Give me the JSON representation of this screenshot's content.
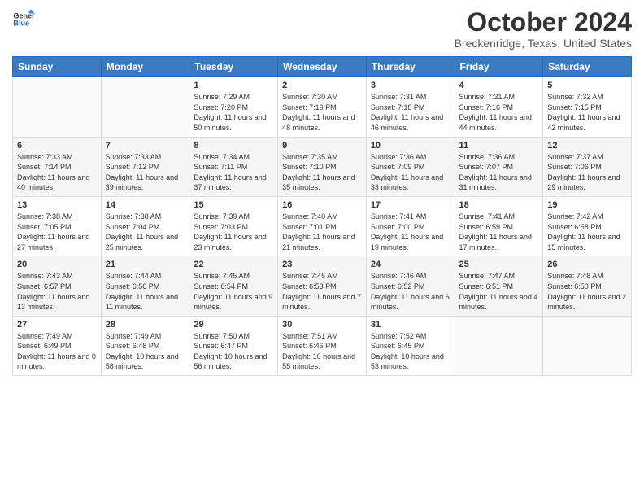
{
  "logo": {
    "line1": "General",
    "line2": "Blue"
  },
  "title": "October 2024",
  "subtitle": "Breckenridge, Texas, United States",
  "weekdays": [
    "Sunday",
    "Monday",
    "Tuesday",
    "Wednesday",
    "Thursday",
    "Friday",
    "Saturday"
  ],
  "weeks": [
    [
      {
        "day": "",
        "info": ""
      },
      {
        "day": "",
        "info": ""
      },
      {
        "day": "1",
        "info": "Sunrise: 7:29 AM\nSunset: 7:20 PM\nDaylight: 11 hours and 50 minutes."
      },
      {
        "day": "2",
        "info": "Sunrise: 7:30 AM\nSunset: 7:19 PM\nDaylight: 11 hours and 48 minutes."
      },
      {
        "day": "3",
        "info": "Sunrise: 7:31 AM\nSunset: 7:18 PM\nDaylight: 11 hours and 46 minutes."
      },
      {
        "day": "4",
        "info": "Sunrise: 7:31 AM\nSunset: 7:16 PM\nDaylight: 11 hours and 44 minutes."
      },
      {
        "day": "5",
        "info": "Sunrise: 7:32 AM\nSunset: 7:15 PM\nDaylight: 11 hours and 42 minutes."
      }
    ],
    [
      {
        "day": "6",
        "info": "Sunrise: 7:33 AM\nSunset: 7:14 PM\nDaylight: 11 hours and 40 minutes."
      },
      {
        "day": "7",
        "info": "Sunrise: 7:33 AM\nSunset: 7:12 PM\nDaylight: 11 hours and 39 minutes."
      },
      {
        "day": "8",
        "info": "Sunrise: 7:34 AM\nSunset: 7:11 PM\nDaylight: 11 hours and 37 minutes."
      },
      {
        "day": "9",
        "info": "Sunrise: 7:35 AM\nSunset: 7:10 PM\nDaylight: 11 hours and 35 minutes."
      },
      {
        "day": "10",
        "info": "Sunrise: 7:36 AM\nSunset: 7:09 PM\nDaylight: 11 hours and 33 minutes."
      },
      {
        "day": "11",
        "info": "Sunrise: 7:36 AM\nSunset: 7:07 PM\nDaylight: 11 hours and 31 minutes."
      },
      {
        "day": "12",
        "info": "Sunrise: 7:37 AM\nSunset: 7:06 PM\nDaylight: 11 hours and 29 minutes."
      }
    ],
    [
      {
        "day": "13",
        "info": "Sunrise: 7:38 AM\nSunset: 7:05 PM\nDaylight: 11 hours and 27 minutes."
      },
      {
        "day": "14",
        "info": "Sunrise: 7:38 AM\nSunset: 7:04 PM\nDaylight: 11 hours and 25 minutes."
      },
      {
        "day": "15",
        "info": "Sunrise: 7:39 AM\nSunset: 7:03 PM\nDaylight: 11 hours and 23 minutes."
      },
      {
        "day": "16",
        "info": "Sunrise: 7:40 AM\nSunset: 7:01 PM\nDaylight: 11 hours and 21 minutes."
      },
      {
        "day": "17",
        "info": "Sunrise: 7:41 AM\nSunset: 7:00 PM\nDaylight: 11 hours and 19 minutes."
      },
      {
        "day": "18",
        "info": "Sunrise: 7:41 AM\nSunset: 6:59 PM\nDaylight: 11 hours and 17 minutes."
      },
      {
        "day": "19",
        "info": "Sunrise: 7:42 AM\nSunset: 6:58 PM\nDaylight: 11 hours and 15 minutes."
      }
    ],
    [
      {
        "day": "20",
        "info": "Sunrise: 7:43 AM\nSunset: 6:57 PM\nDaylight: 11 hours and 13 minutes."
      },
      {
        "day": "21",
        "info": "Sunrise: 7:44 AM\nSunset: 6:56 PM\nDaylight: 11 hours and 11 minutes."
      },
      {
        "day": "22",
        "info": "Sunrise: 7:45 AM\nSunset: 6:54 PM\nDaylight: 11 hours and 9 minutes."
      },
      {
        "day": "23",
        "info": "Sunrise: 7:45 AM\nSunset: 6:53 PM\nDaylight: 11 hours and 7 minutes."
      },
      {
        "day": "24",
        "info": "Sunrise: 7:46 AM\nSunset: 6:52 PM\nDaylight: 11 hours and 6 minutes."
      },
      {
        "day": "25",
        "info": "Sunrise: 7:47 AM\nSunset: 6:51 PM\nDaylight: 11 hours and 4 minutes."
      },
      {
        "day": "26",
        "info": "Sunrise: 7:48 AM\nSunset: 6:50 PM\nDaylight: 11 hours and 2 minutes."
      }
    ],
    [
      {
        "day": "27",
        "info": "Sunrise: 7:49 AM\nSunset: 6:49 PM\nDaylight: 11 hours and 0 minutes."
      },
      {
        "day": "28",
        "info": "Sunrise: 7:49 AM\nSunset: 6:48 PM\nDaylight: 10 hours and 58 minutes."
      },
      {
        "day": "29",
        "info": "Sunrise: 7:50 AM\nSunset: 6:47 PM\nDaylight: 10 hours and 56 minutes."
      },
      {
        "day": "30",
        "info": "Sunrise: 7:51 AM\nSunset: 6:46 PM\nDaylight: 10 hours and 55 minutes."
      },
      {
        "day": "31",
        "info": "Sunrise: 7:52 AM\nSunset: 6:45 PM\nDaylight: 10 hours and 53 minutes."
      },
      {
        "day": "",
        "info": ""
      },
      {
        "day": "",
        "info": ""
      }
    ]
  ]
}
